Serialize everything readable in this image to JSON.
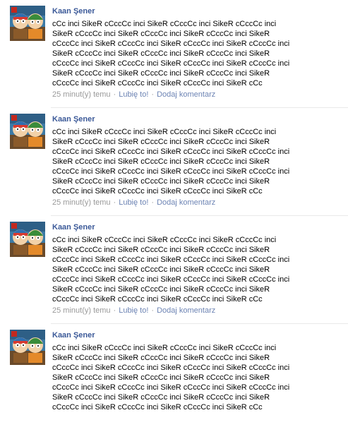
{
  "posts": [
    {
      "author": "Kaan Şener",
      "lines": [
        "cCc inci SikeR cCccCc inci SikeR cCccCc inci SikeR cCccCc inci",
        "SikeR cCccCc inci SikeR cCccCc inci SikeR cCccCc inci SikeR",
        "cCccCc inci SikeR cCccCc inci SikeR cCccCc inci SikeR cCccCc inci",
        "SikeR cCccCc inci SikeR cCccCc inci SikeR cCccCc inci SikeR",
        "cCccCc inci SikeR cCccCc inci SikeR cCccCc inci SikeR cCccCc inci",
        "SikeR cCccCc inci SikeR cCccCc inci SikeR cCccCc inci SikeR",
        "cCccCc inci SikeR cCccCc inci SikeR cCccCc inci SikeR cCc"
      ],
      "time": "25 minut(y) temu",
      "like": "Lubię to!",
      "comment": "Dodaj komentarz"
    },
    {
      "author": "Kaan Şener",
      "lines": [
        "cCc inci SikeR cCccCc inci SikeR cCccCc inci SikeR cCccCc inci",
        "SikeR cCccCc inci SikeR cCccCc inci SikeR cCccCc inci SikeR",
        "cCccCc inci SikeR cCccCc inci SikeR cCccCc inci SikeR cCccCc inci",
        "SikeR cCccCc inci SikeR cCccCc inci SikeR cCccCc inci SikeR",
        "cCccCc inci SikeR cCccCc inci SikeR cCccCc inci SikeR cCccCc inci",
        "SikeR cCccCc inci SikeR cCccCc inci SikeR cCccCc inci SikeR",
        "cCccCc inci SikeR cCccCc inci SikeR cCccCc inci SikeR cCc"
      ],
      "time": "25 minut(y) temu",
      "like": "Lubię to!",
      "comment": "Dodaj komentarz"
    },
    {
      "author": "Kaan Şener",
      "lines": [
        "cCc inci SikeR cCccCc inci SikeR cCccCc inci SikeR cCccCc inci",
        "SikeR cCccCc inci SikeR cCccCc inci SikeR cCccCc inci SikeR",
        "cCccCc inci SikeR cCccCc inci SikeR cCccCc inci SikeR cCccCc inci",
        "SikeR cCccCc inci SikeR cCccCc inci SikeR cCccCc inci SikeR",
        "cCccCc inci SikeR cCccCc inci SikeR cCccCc inci SikeR cCccCc inci",
        "SikeR cCccCc inci SikeR cCccCc inci SikeR cCccCc inci SikeR",
        "cCccCc inci SikeR cCccCc inci SikeR cCccCc inci SikeR cCc"
      ],
      "time": "25 minut(y) temu",
      "like": "Lubię to!",
      "comment": "Dodaj komentarz"
    },
    {
      "author": "Kaan Şener",
      "lines": [
        "cCc inci SikeR cCccCc inci SikeR cCccCc inci SikeR cCccCc inci",
        "SikeR cCccCc inci SikeR cCccCc inci SikeR cCccCc inci SikeR",
        "cCccCc inci SikeR cCccCc inci SikeR cCccCc inci SikeR cCccCc inci",
        "SikeR cCccCc inci SikeR cCccCc inci SikeR cCccCc inci SikeR",
        "cCccCc inci SikeR cCccCc inci SikeR cCccCc inci SikeR cCccCc inci",
        "SikeR cCccCc inci SikeR cCccCc inci SikeR cCccCc inci SikeR",
        "cCccCc inci SikeR cCccCc inci SikeR cCccCc inci SikeR cCc"
      ],
      "time": "",
      "like": "",
      "comment": ""
    }
  ]
}
